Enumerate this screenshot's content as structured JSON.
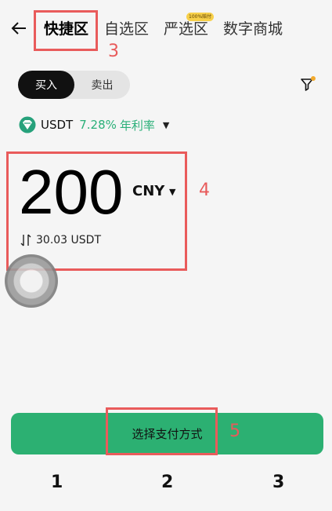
{
  "header": {
    "tabs": [
      "快捷区",
      "自选区",
      "严选区",
      "数字商城"
    ],
    "badge": "100%赔付"
  },
  "segment": {
    "buy": "买入",
    "sell": "卖出"
  },
  "coin": {
    "name": "USDT",
    "rate": "7.28%",
    "rate_label": "年利率"
  },
  "amount": {
    "value": "200",
    "currency": "CNY",
    "converted": "30.03 USDT"
  },
  "pay_button": "选择支付方式",
  "annotations": [
    "3",
    "4",
    "5"
  ],
  "bottom_labels": [
    "1",
    "2",
    "3"
  ],
  "colors": {
    "accent": "#2cb072",
    "annotation": "#e95b5b",
    "badge": "#f7d04a"
  }
}
